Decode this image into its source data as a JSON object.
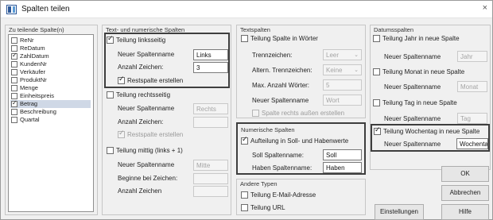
{
  "window": {
    "title": "Spalten teilen",
    "close_glyph": "×"
  },
  "columns_group": {
    "title": "Zu teilende Spalte(n)",
    "items": [
      {
        "label": "ReNr",
        "checked": false,
        "selected": false
      },
      {
        "label": "ReDatum",
        "checked": false,
        "selected": false
      },
      {
        "label": "ZahlDatum",
        "checked": true,
        "selected": false
      },
      {
        "label": "KundenNr",
        "checked": false,
        "selected": false
      },
      {
        "label": "Verkäufer",
        "checked": false,
        "selected": false
      },
      {
        "label": "ProduktNr",
        "checked": false,
        "selected": false
      },
      {
        "label": "Menge",
        "checked": false,
        "selected": false
      },
      {
        "label": "Einheitspreis",
        "checked": false,
        "selected": false
      },
      {
        "label": "Betrag",
        "checked": true,
        "selected": true
      },
      {
        "label": "Beschreibung",
        "checked": false,
        "selected": false
      },
      {
        "label": "Quartal",
        "checked": false,
        "selected": false
      }
    ]
  },
  "text_numeric": {
    "title": "Text- und numerische Spalten",
    "left": {
      "checkbox": "Teilung linksseitig",
      "name_label": "Neuer Spaltenname",
      "name_value": "Links",
      "chars_label": "Anzahl Zeichen:",
      "chars_value": "3",
      "rest_label": "Restspalte erstellen"
    },
    "right": {
      "checkbox": "Teilung rechtsseitig",
      "name_label": "Neuer Spaltenname",
      "name_value": "Rechts",
      "chars_label": "Anzahl Zeichen:",
      "chars_value": "",
      "rest_label": "Restspalte erstellen"
    },
    "middle": {
      "checkbox": "Teilung mittig (links + 1)",
      "name_label": "Neuer Spaltenname",
      "name_value": "Mitte",
      "start_label": "Beginne bei Zeichen:",
      "start_value": "",
      "chars_label": "Anzahl Zeichen",
      "chars_value": ""
    }
  },
  "text_columns": {
    "title": "Textspalten",
    "words_checkbox": "Teilung Spalte in Wörter",
    "sep_label": "Trennzeichen:",
    "sep_value": "Leer",
    "alt_sep_label": "Altern. Trennzeichen:",
    "alt_sep_value": "Keine",
    "max_words_label": "Max. Anzahl Wörter:",
    "max_words_value": "5",
    "name_label": "Neuer Spaltenname",
    "name_value": "Wort",
    "outside_label": "Spalte rechts außen erstellen"
  },
  "numeric_columns": {
    "title": "Numerische Spalten",
    "checkbox": "Aufteilung in Soll- und Habenwerte",
    "soll_label": "Soll Spaltenname:",
    "soll_value": "Soll",
    "haben_label": "Haben Spaltenname:",
    "haben_value": "Haben"
  },
  "other_types": {
    "title": "Andere Typen",
    "email": "Teilung E-Mail-Adresse",
    "url": "Teilung URL"
  },
  "date_columns": {
    "title": "Datumsspalten",
    "year_checkbox": "Teilung Jahr in neue Spalte",
    "year_name_label": "Neuer Spaltenname",
    "year_name_value": "Jahr",
    "month_checkbox": "Teilung Monat in neue Spalte",
    "month_name_label": "Neuer Spaltenname",
    "month_name_value": "Monat",
    "day_checkbox": "Teilung Tag in neue Spalte",
    "day_name_label": "Neuer Spaltenname",
    "day_name_value": "Tag",
    "weekday_checkbox": "Teilung Wochentag in neue Spalte",
    "weekday_name_label": "Neuer Spaltenname",
    "weekday_name_value": "Wochentag"
  },
  "buttons": {
    "ok": "OK",
    "cancel": "Abbrechen",
    "settings": "Einstellungen",
    "help": "Hilfe"
  },
  "dropdown_arrow": "⌄"
}
